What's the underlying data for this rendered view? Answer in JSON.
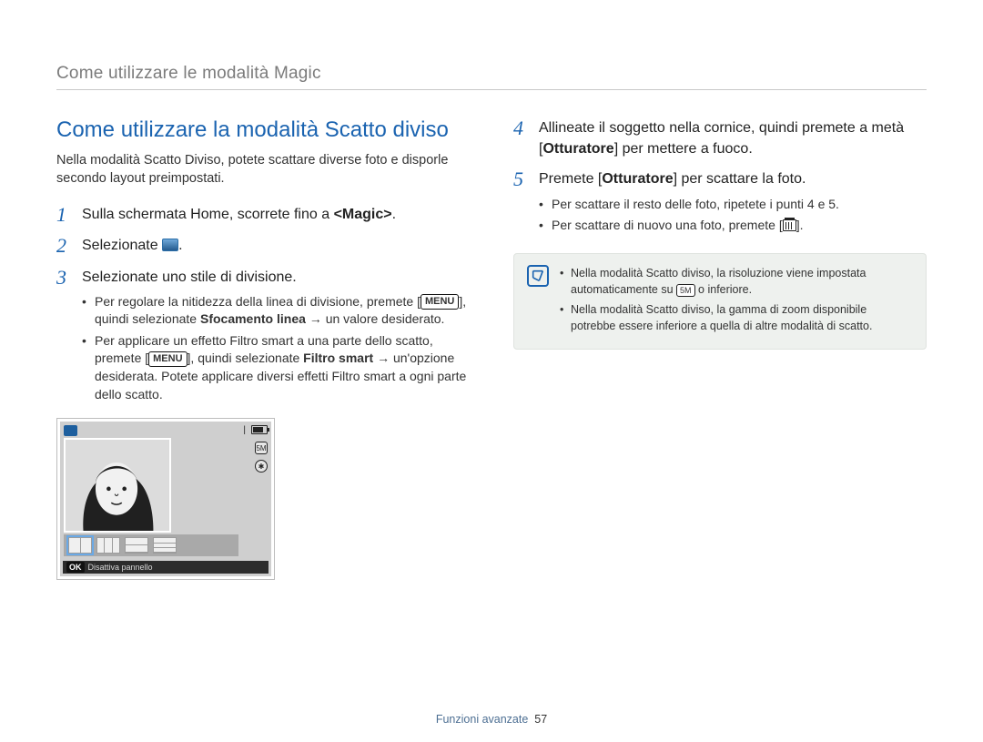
{
  "header": {
    "breadcrumb": "Come utilizzare le modalità Magic"
  },
  "title": "Come utilizzare la modalità Scatto diviso",
  "intro": "Nella modalità Scatto Diviso, potete scattare diverse foto e disporle secondo layout preimpostati.",
  "steps_left": {
    "s1": {
      "num": "1",
      "pre": "Sulla schermata Home, scorrete fino a ",
      "bold": "<Magic>",
      "post": "."
    },
    "s2": {
      "num": "2",
      "pre": "Selezionate ",
      "post": "."
    },
    "s3": {
      "num": "3",
      "text": "Selezionate uno stile di divisione.",
      "bullets": [
        {
          "pre": "Per regolare la nitidezza della linea di divisione, premete [",
          "menu": "MENU",
          "mid": "], quindi selezionate ",
          "bold": "Sfocamento linea",
          "arrow": " → ",
          "post": "un valore desiderato."
        },
        {
          "pre": "Per applicare un effetto Filtro smart a una parte dello scatto, premete [",
          "menu": "MENU",
          "mid": "], quindi selezionate ",
          "bold": "Filtro smart",
          "arrow": " → ",
          "post": "un'opzione desiderata. Potete applicare diversi effetti Filtro smart a ogni parte dello scatto."
        }
      ]
    }
  },
  "steps_right": {
    "s4": {
      "num": "4",
      "pre": "Allineate il soggetto nella cornice, quindi premete a metà [",
      "bold": "Otturatore",
      "post": "] per mettere a fuoco."
    },
    "s5": {
      "num": "5",
      "pre": "Premete [",
      "bold": "Otturatore",
      "post": "] per scattare la foto.",
      "bullets": [
        {
          "text": "Per scattare il resto delle foto, ripetete i punti 4 e 5."
        },
        {
          "pre": "Per scattare di nuovo una foto, premete [",
          "icon": "trash",
          "post": "]."
        }
      ]
    }
  },
  "note": {
    "items": [
      {
        "pre": "Nella modalità Scatto diviso, la risoluzione viene impostata automaticamente su ",
        "chip": "5M",
        "post": " o inferiore."
      },
      {
        "text": "Nella modalità Scatto diviso, la gamma di zoom disponibile potrebbe essere inferiore a quella di altre modalità di scatto."
      }
    ]
  },
  "lcd": {
    "exposure_bar": "|",
    "right_icons": {
      "a": "5M",
      "b": "✱"
    },
    "bottom_ok": "OK",
    "bottom_label": "Disattiva pannello"
  },
  "footer": {
    "section": "Funzioni avanzate",
    "page": "57"
  }
}
